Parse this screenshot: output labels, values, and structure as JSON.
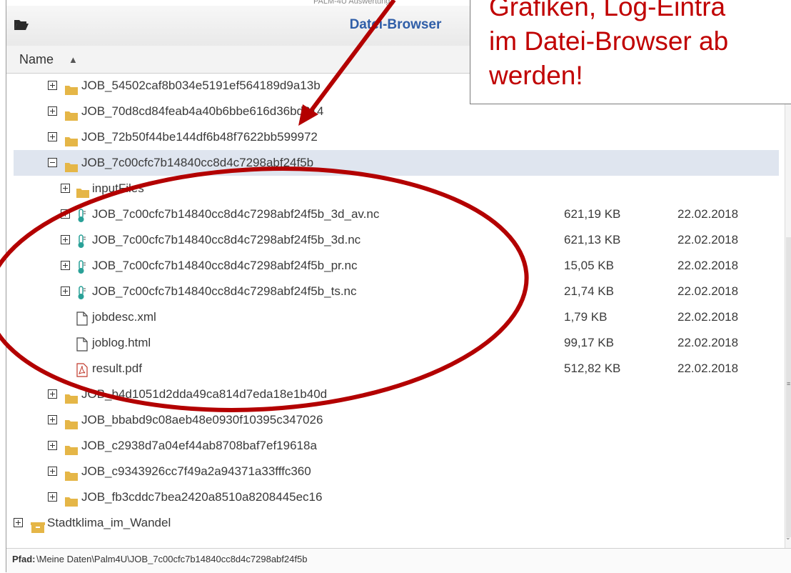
{
  "window": {
    "title": "Datei-Browser",
    "cutoff_header_text": "PALM-4U Auswertung",
    "column_name_label": "Name",
    "sort_icon": "sort-both-icon",
    "folder_open_icon": "folder-open-icon"
  },
  "rows": [
    {
      "name": "JOB_54502caf8b034e5191ef564189d9a13b",
      "icon": "folder-icon",
      "toggle": "plus",
      "indent": 0,
      "size": "",
      "date": "",
      "selected": false
    },
    {
      "name": "JOB_70d8cd84feab4a40b6bbe616d36bd314",
      "icon": "folder-icon",
      "toggle": "plus",
      "indent": 0,
      "size": "",
      "date": "",
      "selected": false
    },
    {
      "name": "JOB_72b50f44be144df6b48f7622bb599972",
      "icon": "folder-icon",
      "toggle": "plus",
      "indent": 0,
      "size": "",
      "date": "",
      "selected": false
    },
    {
      "name": "JOB_7c00cfc7b14840cc8d4c7298abf24f5b",
      "icon": "folder-icon",
      "toggle": "minus",
      "indent": 0,
      "size": "",
      "date": "",
      "selected": true
    },
    {
      "name": "inputFiles",
      "icon": "folder-icon",
      "toggle": "plus",
      "indent": 1,
      "size": "",
      "date": "",
      "selected": false
    },
    {
      "name": "JOB_7c00cfc7b14840cc8d4c7298abf24f5b_3d_av.nc",
      "icon": "thermometer-icon",
      "toggle": "plus",
      "indent": 1,
      "size": "621,19 KB",
      "date": "22.02.2018",
      "selected": false
    },
    {
      "name": "JOB_7c00cfc7b14840cc8d4c7298abf24f5b_3d.nc",
      "icon": "thermometer-icon",
      "toggle": "plus",
      "indent": 1,
      "size": "621,13 KB",
      "date": "22.02.2018",
      "selected": false
    },
    {
      "name": "JOB_7c00cfc7b14840cc8d4c7298abf24f5b_pr.nc",
      "icon": "thermometer-icon",
      "toggle": "plus",
      "indent": 1,
      "size": "15,05 KB",
      "date": "22.02.2018",
      "selected": false
    },
    {
      "name": "JOB_7c00cfc7b14840cc8d4c7298abf24f5b_ts.nc",
      "icon": "thermometer-icon",
      "toggle": "plus",
      "indent": 1,
      "size": "21,74 KB",
      "date": "22.02.2018",
      "selected": false
    },
    {
      "name": "jobdesc.xml",
      "icon": "file-icon",
      "toggle": "none",
      "indent": 1,
      "size": "1,79 KB",
      "date": "22.02.2018",
      "selected": false
    },
    {
      "name": "joblog.html",
      "icon": "file-icon",
      "toggle": "none",
      "indent": 1,
      "size": "99,17 KB",
      "date": "22.02.2018",
      "selected": false
    },
    {
      "name": "result.pdf",
      "icon": "pdf-icon",
      "toggle": "none",
      "indent": 1,
      "size": "512,82 KB",
      "date": "22.02.2018",
      "selected": false
    },
    {
      "name": "JOB_b4d1051d2dda49ca814d7eda18e1b40d",
      "icon": "folder-icon",
      "toggle": "plus",
      "indent": 0,
      "size": "",
      "date": "",
      "selected": false
    },
    {
      "name": "JOB_bbabd9c08aeb48e0930f10395c347026",
      "icon": "folder-icon",
      "toggle": "plus",
      "indent": 0,
      "size": "",
      "date": "",
      "selected": false
    },
    {
      "name": "JOB_c2938d7a04ef44ab8708baf7ef19618a",
      "icon": "folder-icon",
      "toggle": "plus",
      "indent": 0,
      "size": "",
      "date": "",
      "selected": false
    },
    {
      "name": "JOB_c9343926cc7f49a2a94371a33fffc360",
      "icon": "folder-icon",
      "toggle": "plus",
      "indent": 0,
      "size": "",
      "date": "",
      "selected": false
    },
    {
      "name": "JOB_fb3cddc7bea2420a8510a8208445ec16",
      "icon": "folder-icon",
      "toggle": "plus",
      "indent": 0,
      "size": "",
      "date": "",
      "selected": false
    },
    {
      "name": "Stadtklima_im_Wandel",
      "icon": "archive-box-icon",
      "toggle": "plus",
      "indent": -1,
      "size": "",
      "date": "",
      "selected": false
    }
  ],
  "path_bar": {
    "label": "Pfad:",
    "value": "\\Meine Daten\\Palm4U\\JOB_7c00cfc7b14840cc8d4c7298abf24f5b"
  },
  "annotation": {
    "lines": [
      "Grafiken, Log-Einträ",
      "im Datei-Browser ab",
      "werden!"
    ],
    "color": "#c00000"
  },
  "colors": {
    "title": "#2f5ea8",
    "folder": "#e5b647",
    "selected_row": "#dfe5ef",
    "pdf": "#c0392b",
    "thermometer": "#2aa198"
  }
}
